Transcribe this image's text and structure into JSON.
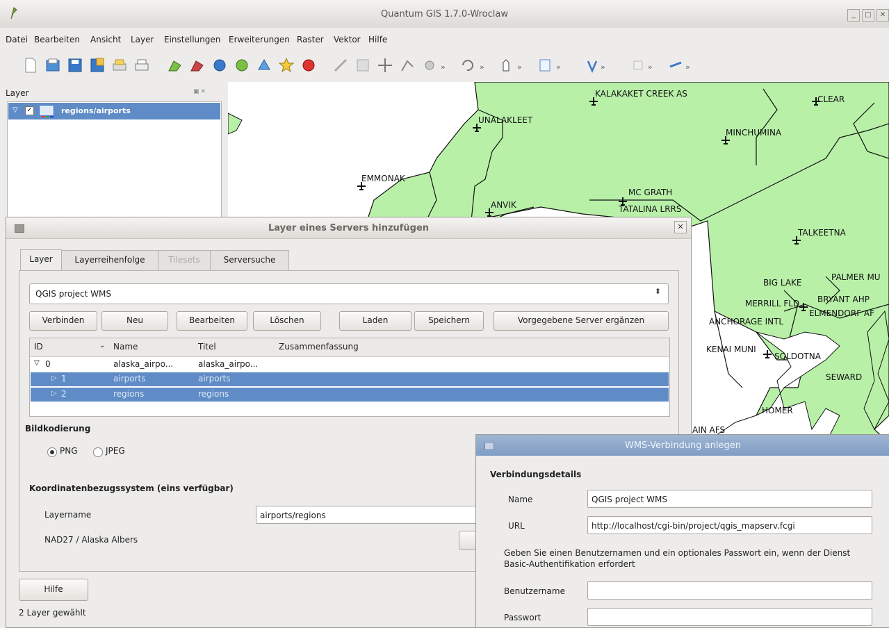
{
  "window": {
    "title": "Quantum GIS 1.7.0-Wroclaw"
  },
  "menu": [
    "Datei",
    "Bearbeiten",
    "Ansicht",
    "Layer",
    "Einstellungen",
    "Erweiterungen",
    "Raster",
    "Vektor",
    "Hilfe"
  ],
  "toolbar": {
    "overflow": "»"
  },
  "layer_panel": {
    "title": "Layer",
    "layer_name": "regions/airports"
  },
  "map": {
    "labels": [
      "KALAKAKET CREEK AS",
      "CLEAR",
      "UNALAKLEET",
      "MINCHUMINA",
      "EMMONAK",
      "MC GRATH",
      "ANVIK",
      "TATALINA LRRS",
      "TALKEETNA",
      "BIG LAKE",
      "PALMER MU",
      "MERRILL FLD",
      "BRYANT AHP",
      "ANCHORAGE INTL",
      "ELMENDORF AF",
      "KENAI MUNI",
      "SOLDOTNA",
      "SEWARD",
      "HOMER",
      "AIN AFS"
    ],
    "colors": {
      "land": "#b8f0a8",
      "water": "#ffffff",
      "boundary": "#111111"
    }
  },
  "dialog1": {
    "title": "Layer eines Servers hinzufügen",
    "tabs": [
      "Layer",
      "Layerreihenfolge",
      "Tilesets",
      "Serversuche"
    ],
    "server_combo": "QGIS project WMS",
    "buttons": {
      "connect": "Verbinden",
      "new": "Neu",
      "edit": "Bearbeiten",
      "delete": "Löschen",
      "load": "Laden",
      "save": "Speichern",
      "add_default": "Vorgegebene Server ergänzen"
    },
    "table": {
      "headers": [
        "ID",
        "Name",
        "Titel",
        "Zusammenfassung"
      ],
      "rows": [
        {
          "id": "0",
          "name": "alaska_airpo...",
          "title": "alaska_airpo..."
        },
        {
          "id": "1",
          "name": "airports",
          "title": "airports"
        },
        {
          "id": "2",
          "name": "regions",
          "title": "regions"
        }
      ]
    },
    "encoding": {
      "label": "Bildkodierung",
      "png": "PNG",
      "jpeg": "JPEG",
      "selected": "PNG"
    },
    "crs": {
      "label": "Koordinatenbezugssystem (eins verfügbar)",
      "layername_label": "Layername",
      "layername_value": "airports/regions",
      "crs_value": "NAD27 / Alaska Albers"
    },
    "help_button": "Hilfe",
    "status": "2 Layer gewählt"
  },
  "dialog2": {
    "title": "WMS-Verbindung anlegen",
    "section": "Verbindungsdetails",
    "name_label": "Name",
    "name_value": "QGIS project WMS",
    "url_label": "URL",
    "url_value": "http://localhost/cgi-bin/project/qgis_mapserv.fcgi",
    "auth_hint": "Geben Sie einen Benutzernamen und ein optionales Passwort ein, wenn der Dienst Basic-Authentifikation erfordert",
    "user_label": "Benutzername",
    "user_value": "",
    "password_label": "Passwort",
    "password_value": ""
  }
}
